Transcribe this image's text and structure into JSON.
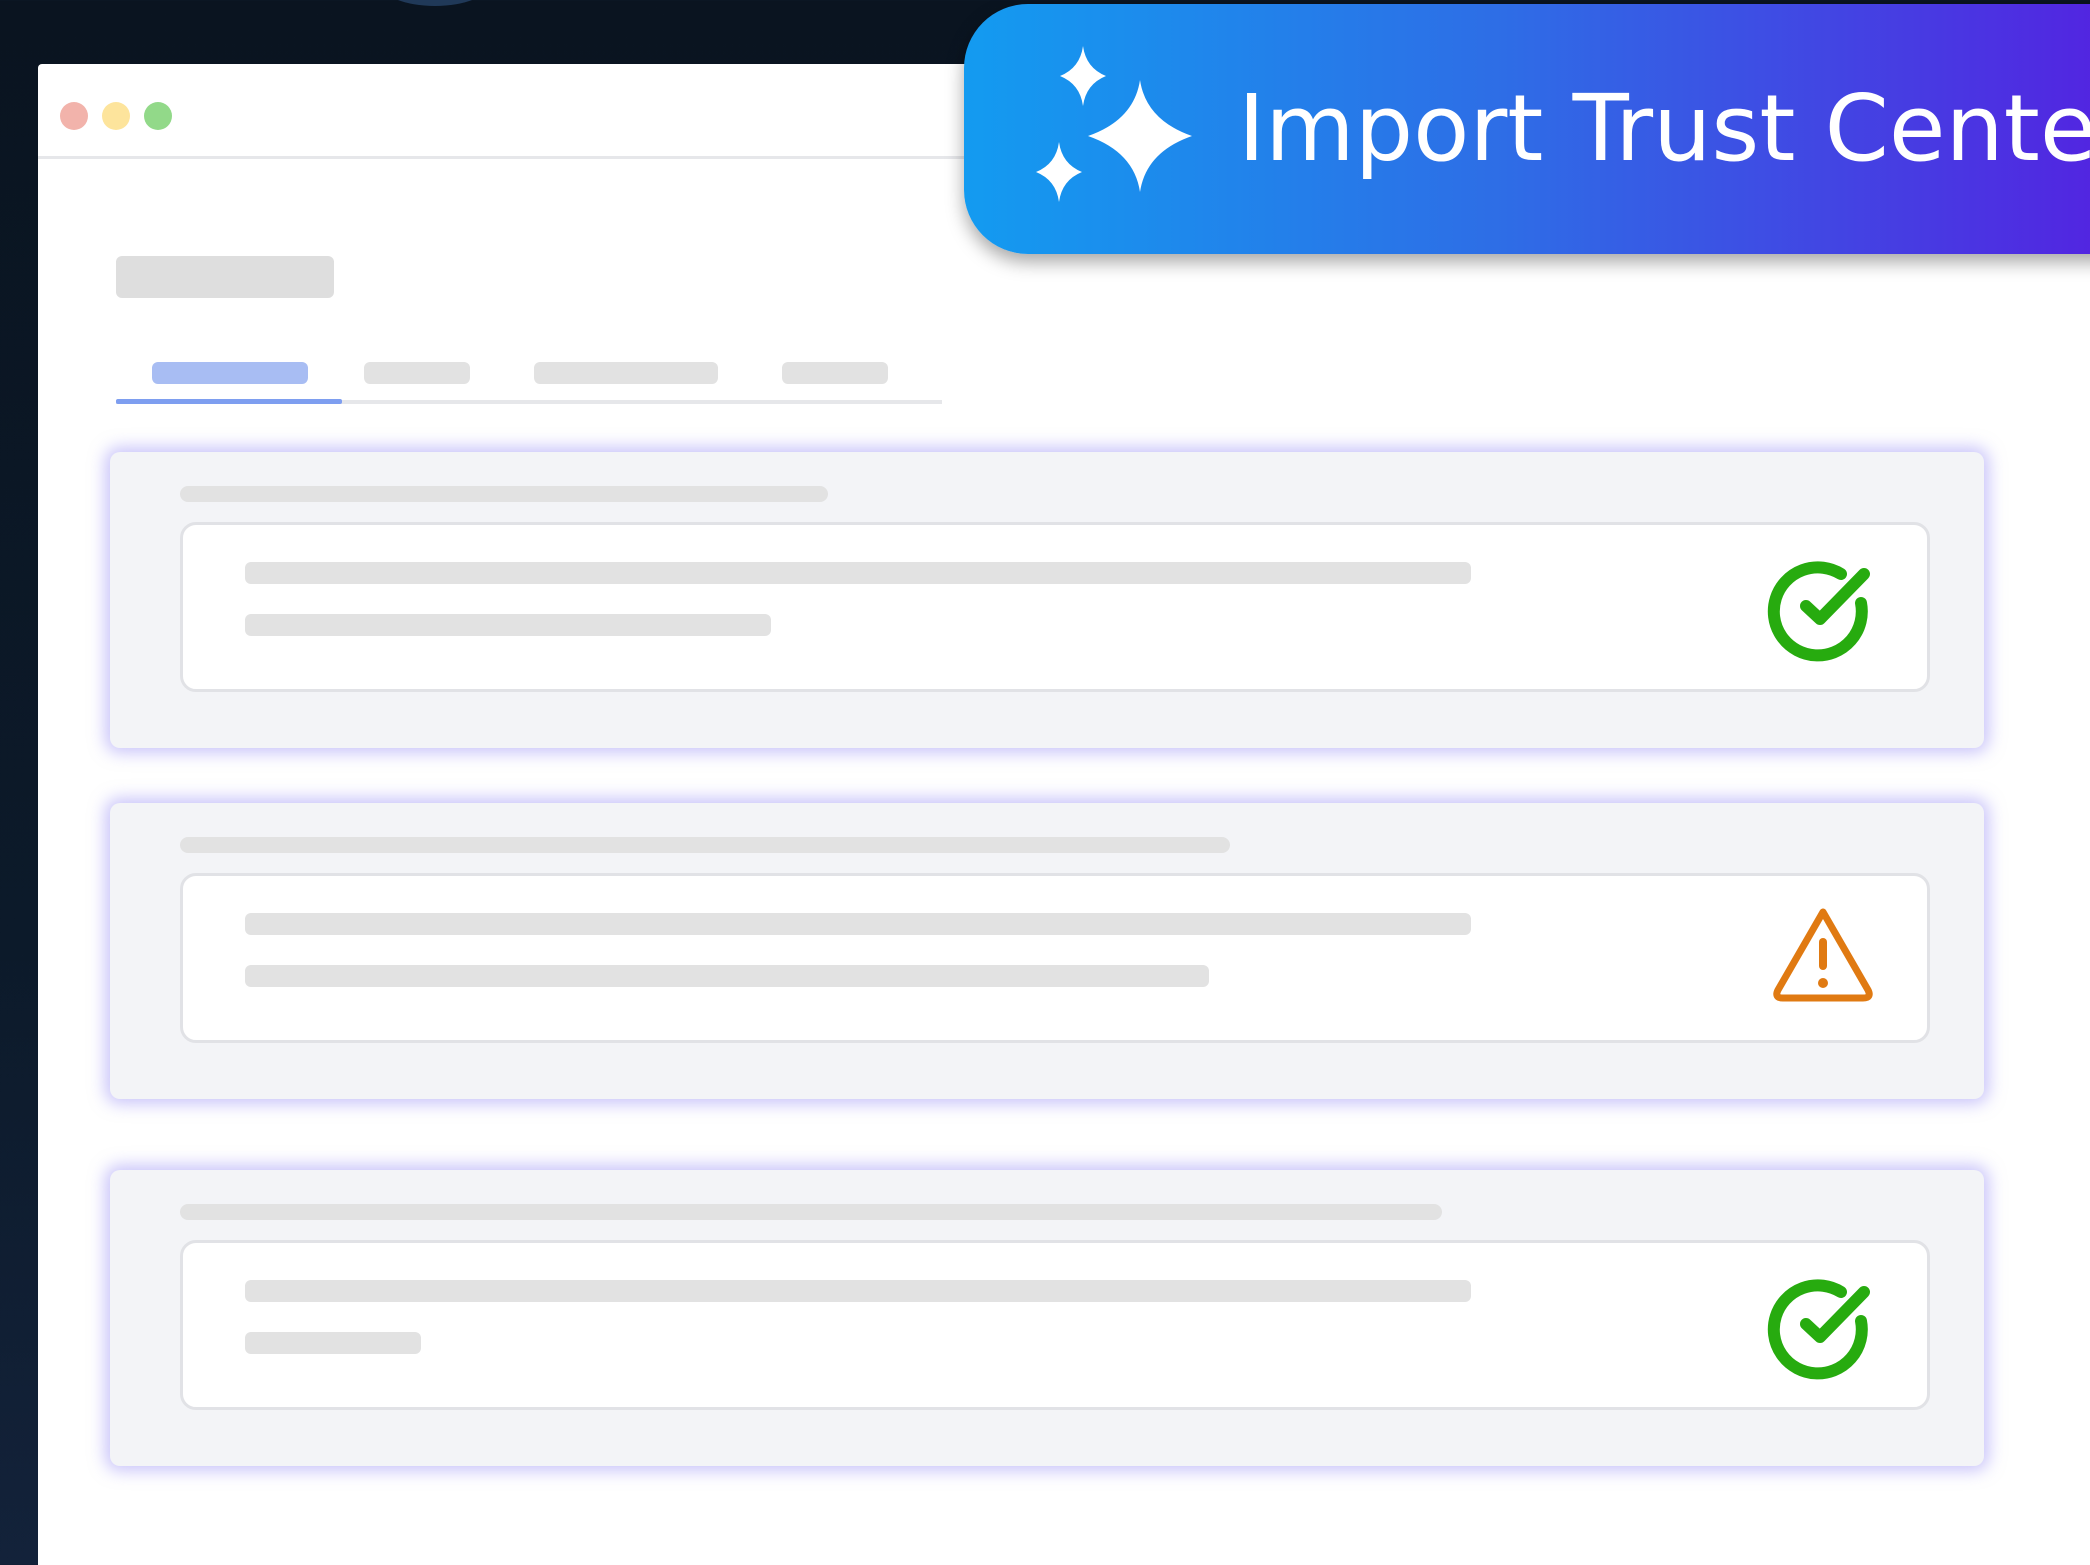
{
  "window": {
    "controls": [
      {
        "name": "close",
        "color": "#f2b3ab"
      },
      {
        "name": "minimize",
        "color": "#fde49c"
      },
      {
        "name": "maximize",
        "color": "#92d989"
      }
    ]
  },
  "banner": {
    "label": "Import Trust Center",
    "icon": "sparkles-icon",
    "gradient": [
      "#139bf0",
      "#2e6de6",
      "#561de0"
    ]
  },
  "tabs": {
    "count": 4,
    "active_index": 0,
    "active_color": "#a8bdf3",
    "indicator_color": "#7e9ef0"
  },
  "items": [
    {
      "status": "success",
      "icon": "check-circle-icon",
      "color": "#27ab0f"
    },
    {
      "status": "warning",
      "icon": "warning-triangle-icon",
      "color": "#e07a12"
    },
    {
      "status": "success",
      "icon": "check-circle-icon",
      "color": "#27ab0f"
    }
  ]
}
